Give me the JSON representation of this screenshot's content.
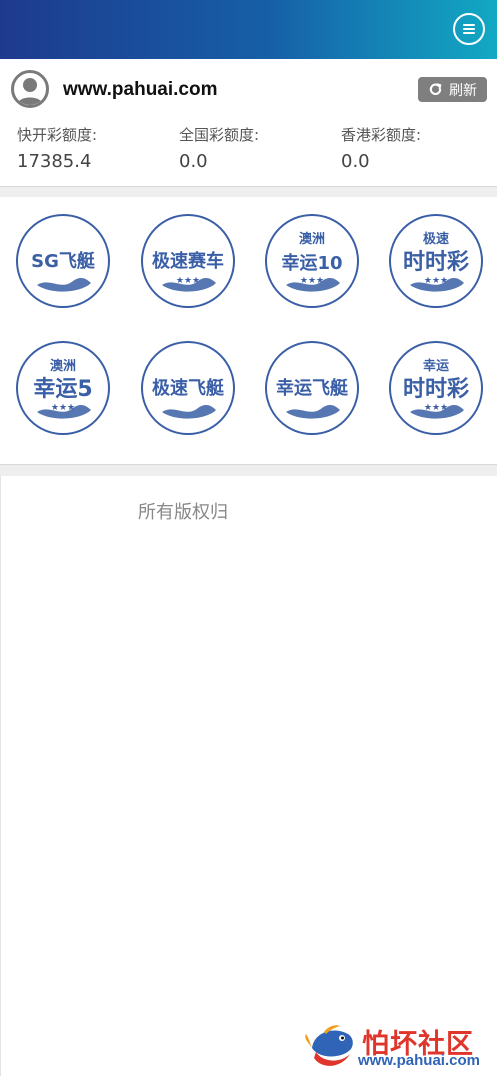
{
  "header": {
    "menu_icon": "hamburger-icon"
  },
  "user": {
    "site": "www.pahuai.com",
    "avatar_icon": "user-avatar-icon",
    "refresh_label": "刷新",
    "refresh_icon": "refresh-icon"
  },
  "quotas": [
    {
      "label": "快开彩额度:",
      "value": "17385.4"
    },
    {
      "label": "全国彩额度:",
      "value": "0.0"
    },
    {
      "label": "香港彩额度:",
      "value": "0.0"
    }
  ],
  "games": [
    {
      "top": "",
      "main": "SG飞艇",
      "stars": false
    },
    {
      "top": "",
      "main": "极速赛车",
      "stars": true
    },
    {
      "top": "澳洲",
      "main": "幸运10",
      "stars": true
    },
    {
      "top": "极速",
      "main": "时时彩",
      "stars": true
    },
    {
      "top": "澳洲",
      "main": "幸运5",
      "stars": true
    },
    {
      "top": "",
      "main": "极速飞艇",
      "stars": false
    },
    {
      "top": "",
      "main": "幸运飞艇",
      "stars": false
    },
    {
      "top": "幸运",
      "main": "时时彩",
      "stars": true
    }
  ],
  "footer": {
    "copyright": "所有版权归"
  },
  "watermark": {
    "title": "怕坏社区",
    "url": "www.pahuai.com"
  },
  "colors": {
    "accent": "#3a5fa6",
    "header_start": "#1e3a8e",
    "header_end": "#12a9c4",
    "watermark_red": "#e0352b"
  }
}
